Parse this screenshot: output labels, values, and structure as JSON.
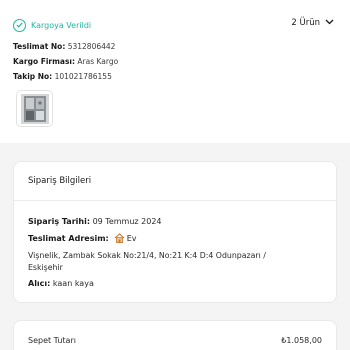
{
  "shipment": {
    "status": "Kargoya Verildi",
    "status_color": "#1db7a2",
    "item_count": "2 Ürün",
    "delivery_no_label": "Teslimat No:",
    "delivery_no": "5312806442",
    "cargo_label": "Kargo Firması:",
    "cargo": "Aras Kargo",
    "tracking_label": "Takip No:",
    "tracking": "101021786155"
  },
  "order": {
    "title": "Sipariş Bilgileri",
    "date_label": "Sipariş Tarihi:",
    "date": "09 Temmuz 2024",
    "address_label": "Teslimat Adresim:",
    "address_type": "Ev",
    "address_line1": "Vişnelik, Zambak Sokak No:21/4, No:21 K:4 D:4 Odunpazarı /",
    "address_line2": "Eskişehir",
    "recipient_label": "Alıcı:",
    "recipient": "kaan kaya"
  },
  "totals": {
    "basket_label": "Sepet Tutarı",
    "basket_value": "₺1.058,00"
  }
}
